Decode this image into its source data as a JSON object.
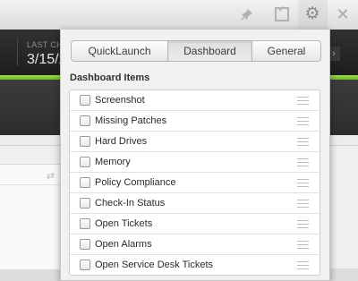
{
  "toolbar": {
    "icons": [
      "pin-icon",
      "popout-icon",
      "gear-icon",
      "close-icon"
    ],
    "close_glyph": "✕",
    "gear_glyph": "⚙",
    "pin_glyph": "📌"
  },
  "background": {
    "label": "LAST CH",
    "value": "3/15/2"
  },
  "popup": {
    "tabs": [
      {
        "label": "QuickLaunch"
      },
      {
        "label": "Dashboard",
        "selected": true
      },
      {
        "label": "General"
      }
    ],
    "section_title": "Dashboard Items",
    "items": [
      {
        "label": "Screenshot",
        "checked": false
      },
      {
        "label": "Missing Patches",
        "checked": false
      },
      {
        "label": "Hard Drives",
        "checked": false
      },
      {
        "label": "Memory",
        "checked": false
      },
      {
        "label": "Policy Compliance",
        "checked": false
      },
      {
        "label": "Check-In Status",
        "checked": false
      },
      {
        "label": "Open Tickets",
        "checked": false
      },
      {
        "label": "Open Alarms",
        "checked": false
      },
      {
        "label": "Open Service Desk Tickets",
        "checked": false
      }
    ]
  },
  "colors": {
    "accent_green": "#8fd33f",
    "dark_band": "#262626"
  }
}
